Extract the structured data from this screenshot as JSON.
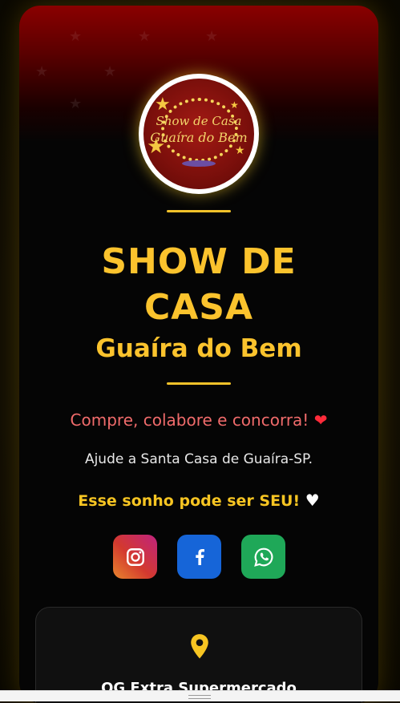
{
  "header": {
    "logo": {
      "line1": "Show de Casa",
      "line2": "Guaíra do Bem"
    }
  },
  "hero": {
    "title_line1": "SHOW DE",
    "title_line2": "CASA",
    "subtitle": "Guaíra do Bem"
  },
  "intro": {
    "tagline": "Compre, colabore e concorra!",
    "tagline_icon": "heart-icon",
    "help_text": "Ajude a Santa Casa de Guaíra-SP.",
    "dream_text": "Esse sonho pode ser SEU!",
    "dream_icon": "white-heart-icon"
  },
  "social": [
    {
      "name": "instagram",
      "icon": "instagram-icon"
    },
    {
      "name": "facebook",
      "icon": "facebook-icon"
    },
    {
      "name": "whatsapp",
      "icon": "whatsapp-icon"
    }
  ],
  "location": {
    "icon": "map-pin-icon",
    "name": "OG Extra Supermercado"
  },
  "colors": {
    "accent": "#fbc32d",
    "tagline": "#f06b6b",
    "heart": "#ff2b3a",
    "instagram": "#c0237f",
    "facebook": "#1665d8",
    "whatsapp": "#1fa858"
  }
}
